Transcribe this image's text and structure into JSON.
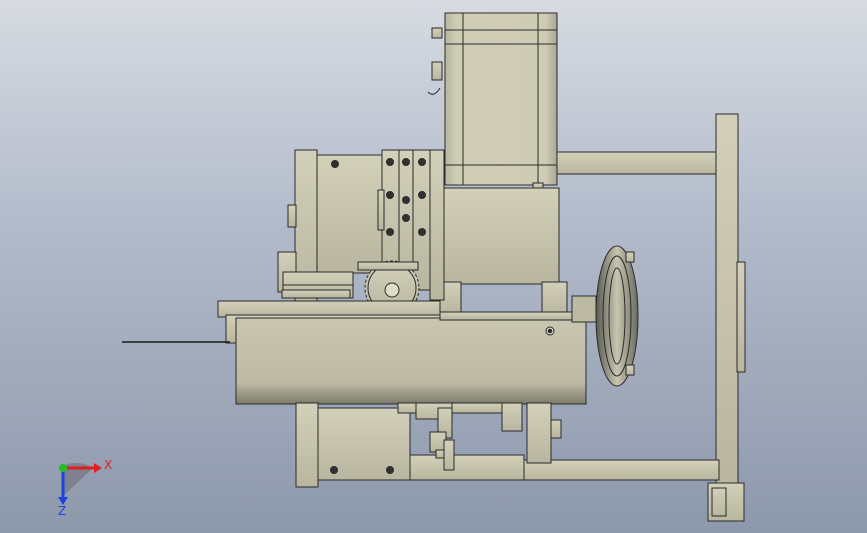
{
  "viewport": {
    "background_top": "#d7dbe1",
    "background_bottom": "#8d98ab"
  },
  "model": {
    "body_color": "#c9c6b0",
    "body_shade": "#a9a692",
    "edge_color": "#2a2a2a",
    "hole_color": "#303030"
  },
  "triad": {
    "x_label": "X",
    "z_label": "Z",
    "x_color": "#e02020",
    "y_color": "#20c020",
    "z_color": "#2040e0"
  }
}
